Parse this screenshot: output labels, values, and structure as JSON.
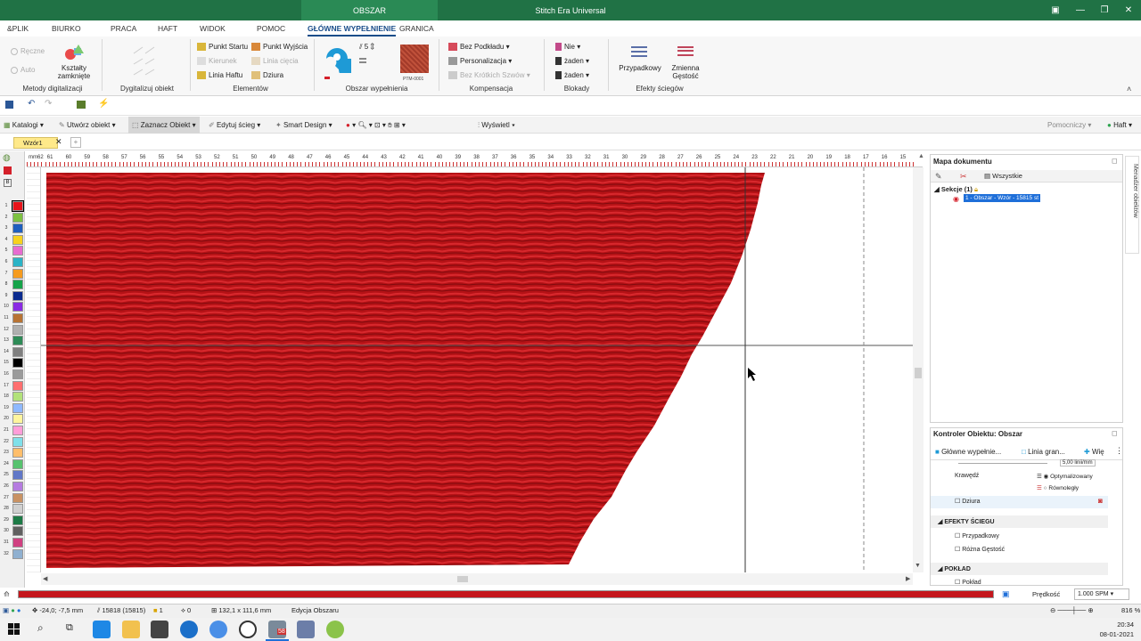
{
  "window": {
    "title": "Stitch Era Universal",
    "context_tab": "OBSZAR"
  },
  "menu": [
    {
      "label": "&PLIK"
    },
    {
      "label": "BIURKO"
    },
    {
      "label": "PRACA"
    },
    {
      "label": "HAFT"
    },
    {
      "label": "WIDOK"
    },
    {
      "label": "POMOC"
    },
    {
      "label": "GŁÓWNE WYPEŁNIENIE"
    },
    {
      "label": "GRANICA"
    }
  ],
  "ribbon": {
    "metody": {
      "group": "Metody digitalizacji",
      "reczne": "Ręczne",
      "auto": "Auto",
      "ksztalty": "Kształty zamknięte"
    },
    "dygitalizuj": {
      "group": "Dygitalizuj obiekt"
    },
    "elementy": {
      "group": "Elementów",
      "punkt_startu": "Punkt Startu",
      "punkt_wyjscia": "Punkt Wyjścia",
      "kierunek": "Kierunek",
      "linia_ciecia": "Linia cięcia",
      "linia_haftu": "Linia Haftu",
      "dziura": "Dziura"
    },
    "obszar": {
      "group": "Obszar wypełnienia",
      "density": "5",
      "pattern": "PTM-0001"
    },
    "kompensacja": {
      "group": "Kompensacja",
      "bez_podkladu": "Bez Podkładu",
      "personalizacja": "Personalizacja",
      "bez_krotkich": "Bez Krótkich Szwów"
    },
    "blokady": {
      "group": "Blokady",
      "nie": "Nie",
      "zaden1": "żaden",
      "zaden2": "żaden"
    },
    "efekty": {
      "group": "Efekty ściegów",
      "przypadkowy": "Przypadkowy",
      "zmienna": "Zmienna Gęstość"
    }
  },
  "toolbar2": {
    "katalogi": "Katalogi",
    "utworz": "Utwórz obiekt",
    "zaznacz": "Zaznacz Obiekt",
    "edytuj": "Edytuj ścieg",
    "smart": "Smart Design",
    "wyswietl": "Wyświetl",
    "pomocniczy": "Pomocniczy",
    "haft": "Haft"
  },
  "doc_tab": "Wzór1",
  "palette": [
    "1",
    "2",
    "3",
    "4",
    "5",
    "6",
    "7",
    "8",
    "9",
    "10",
    "11",
    "12",
    "13",
    "14",
    "15",
    "16",
    "17",
    "18",
    "19",
    "20",
    "21",
    "22",
    "23",
    "24",
    "25",
    "26",
    "27",
    "28",
    "29",
    "30",
    "31",
    "32"
  ],
  "palette_colors": [
    "#e8141b",
    "#7dc242",
    "#1f5fbf",
    "#f7d21e",
    "#e86bd0",
    "#2bb3c6",
    "#f59b1f",
    "#16a34a",
    "#0b2b8f",
    "#8a2be2",
    "#b87333",
    "#b0b0b0",
    "#2e8b57",
    "#808080",
    "#000000",
    "#9b9b9b",
    "#ff6f6f",
    "#b2e27a",
    "#8fb9ff",
    "#fff59d",
    "#ff9dd8",
    "#7fe0ea",
    "#ffbe6b",
    "#56c26e",
    "#6077c7",
    "#b57be0",
    "#c99263",
    "#d0d0d0",
    "#1d7a46",
    "#606060",
    "#d04080",
    "#8fb0d0"
  ],
  "hruler_labels": [
    "mm62",
    "61",
    "60",
    "59",
    "58",
    "57",
    "56",
    "55",
    "54",
    "53",
    "52",
    "51",
    "50",
    "49",
    "48",
    "47",
    "46",
    "45",
    "44",
    "43",
    "42",
    "41",
    "40",
    "39",
    "38",
    "37",
    "36",
    "35",
    "34",
    "33",
    "32",
    "31",
    "30",
    "29",
    "28",
    "27",
    "26",
    "25",
    "24",
    "23",
    "22",
    "21",
    "20",
    "19",
    "18",
    "17",
    "16",
    "15"
  ],
  "doc_map": {
    "title": "Mapa dokumentu",
    "filter": "Wszystkie",
    "section": "Sekcje (1)",
    "item": "1 - Obszar - Wzór - 15815 st"
  },
  "controller": {
    "title": "Kontroler Obiektu: Obszar",
    "tab1": "Główne wypełnie...",
    "tab2": "Linia gran...",
    "tab3": "Wię",
    "spin_value": "5,00 linii/mm",
    "krawedz": "Krawędź",
    "optymalizowany": "Optymalizowany",
    "rownolegly": "Równoległy",
    "dziura": "Dziura",
    "efekty_header": "EFEKTY ŚCIEGU",
    "przypadkowy": "Przypadkowy",
    "rozna": "Różna Gęstość",
    "poklad_header": "POKŁAD",
    "poklad": "Pokład"
  },
  "speed": {
    "label": "Prędkość",
    "value": "1.000 SPM"
  },
  "status": {
    "coords": "-24,0; -7,5 mm",
    "stitches": "15818 (15815)",
    "count1": "1",
    "count2": "0",
    "size": "132,1 x 111,6 mm",
    "mode": "Edycja Obszaru",
    "zoom": "816 %"
  },
  "taskbar": {
    "clock": "20:34",
    "date": "08-01-2021",
    "badge": "58"
  },
  "side_tab": "Menadżer obiektów"
}
